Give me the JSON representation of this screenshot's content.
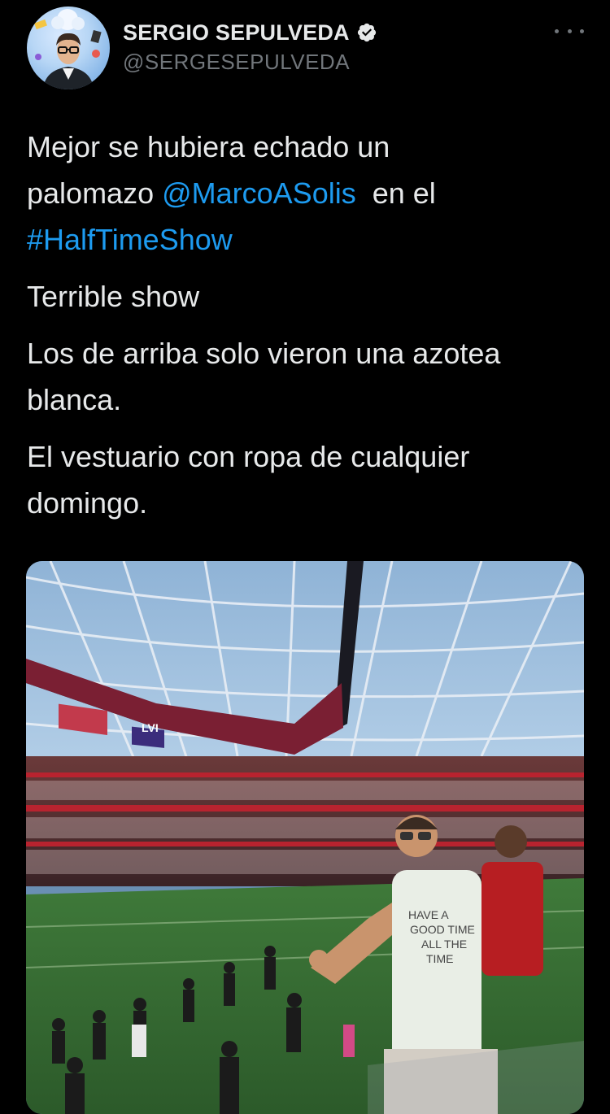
{
  "author": {
    "name": "SERGIO SEPULVEDA",
    "handle": "@SERGESEPULVEDA",
    "verified": true,
    "avatar_icon": "avatar-photo"
  },
  "tweet": {
    "line1_a": "Mejor se hubiera echado un",
    "line1_b": "palomazo ",
    "mention": "@MarcoASolis",
    "line1_c": "  en el",
    "hashtag": "#HalfTimeShow",
    "p2": "Terrible show",
    "p3": "Los de arriba solo vieron una azotea blanca.",
    "p4": "El vestuario con ropa de cualquier domingo."
  },
  "media": {
    "scoreboard_text": "LVI",
    "shirt_text": [
      "HAVE A",
      "GOOD TIME",
      "ALL THE",
      "TIME"
    ]
  },
  "colors": {
    "background": "#000000",
    "text": "#e7e9ea",
    "secondary": "#71767b",
    "link": "#1d9bf0"
  }
}
